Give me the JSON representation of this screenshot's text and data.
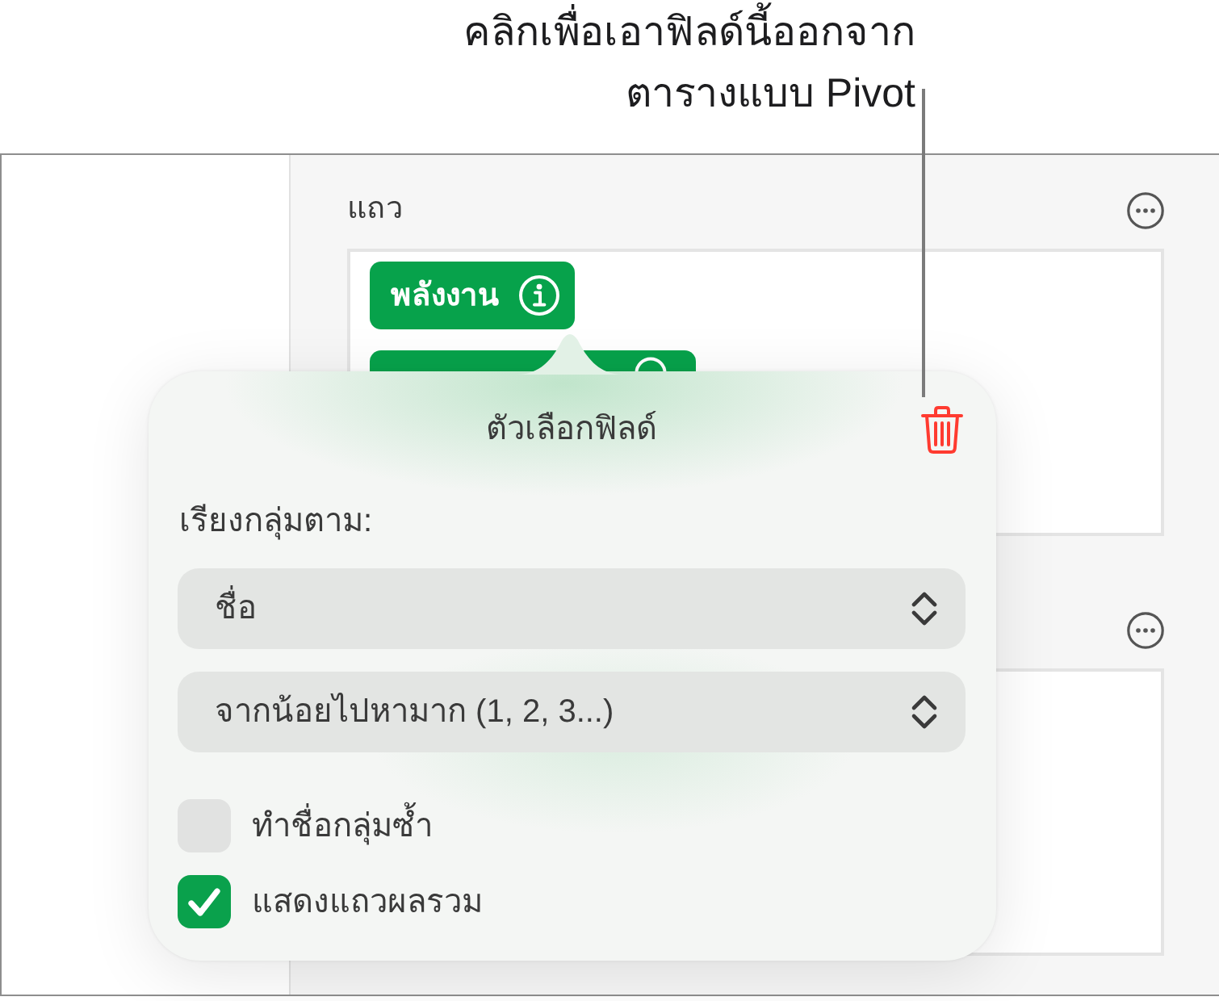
{
  "callout": {
    "text": "คลิกเพื่อเอาฟิลด์นี้ออกจาก\nตารางแบบ Pivot"
  },
  "sidebar": {
    "sections": [
      {
        "kind": "open",
        "label": "แถว",
        "fields": [
          {
            "kind": "tag",
            "label": "พลังงาน"
          },
          {
            "kind": "covered"
          }
        ]
      },
      {
        "kind": "covered"
      }
    ]
  },
  "popover": {
    "title": "ตัวเลือกฟิลด์",
    "group_by_label": "เรียงกลุ่มตาม:",
    "selects": [
      {
        "value": "ชื่อ"
      },
      {
        "value": "จากน้อยไปหามาก (1, 2, 3...)"
      }
    ],
    "options": [
      {
        "label": "ทำชื่อกลุ่มซ้ำ",
        "checked": false
      },
      {
        "label": "แสดงแถวผลรวม",
        "checked": true
      }
    ]
  }
}
